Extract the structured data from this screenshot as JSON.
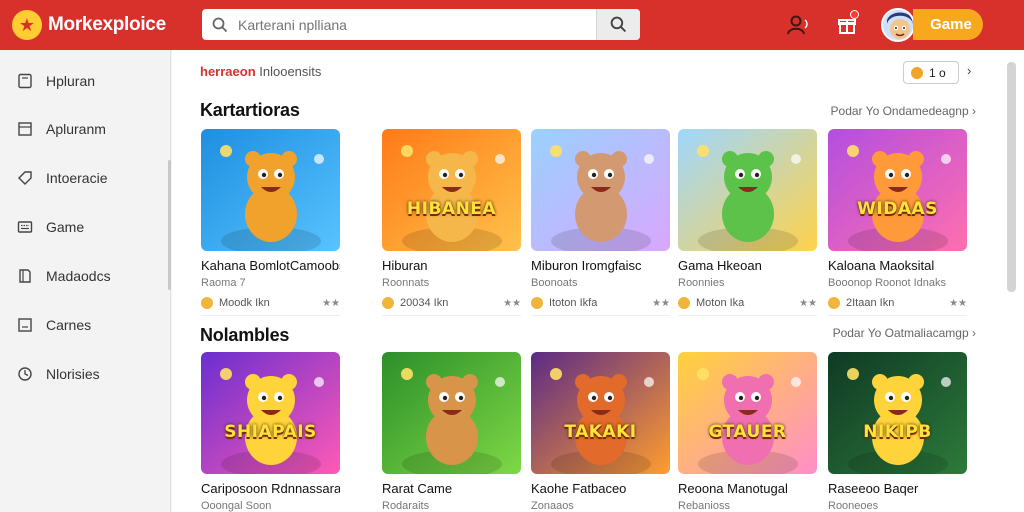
{
  "app": {
    "name": "Morkexploice",
    "logo_icon": "star-logo-icon",
    "brand_color": "#d8312c",
    "accent_color": "#f7a81f"
  },
  "search": {
    "placeholder": "Karterani nplliana"
  },
  "header": {
    "game_button": "Game"
  },
  "sidebar": {
    "items": [
      {
        "label": "Hpluran",
        "icon": "tablet-icon"
      },
      {
        "label": "Apluranm",
        "icon": "document-icon"
      },
      {
        "label": "Intoeracie",
        "icon": "tag-icon"
      },
      {
        "label": "Game",
        "icon": "keyboard-icon"
      },
      {
        "label": "Madaodcs",
        "icon": "bookmark-icon"
      },
      {
        "label": "Carnes",
        "icon": "image-icon"
      },
      {
        "label": "Nlorisies",
        "icon": "clock-icon"
      }
    ]
  },
  "main": {
    "subhead_red": "herraeon",
    "subhead_rest": "Inlooensits",
    "coins": "1 o",
    "sections": [
      {
        "title": "Kartartioras",
        "more": "Podar Yo Ondamedeagnp",
        "cards": [
          {
            "title": "Kahana BomlotCamoobs",
            "sub": "Raoma 7",
            "meta": "Moodk Ikn",
            "right": "★★"
          },
          {
            "title": "Hiburan",
            "sub": "Roonnats",
            "meta": "20034 Ikn",
            "right": "★★"
          },
          {
            "title": "Miburon Iromgfaisc",
            "sub": "Boonoats",
            "meta": "Itoton Ikfa",
            "right": "★★"
          },
          {
            "title": "Gama Hkeoan",
            "sub": "Roonnies",
            "meta": "Moton Ika",
            "right": "★★"
          },
          {
            "title": "Kaloana Maoksital",
            "sub": "Booonop Roonot Idnaks",
            "meta": "2Itaan Ikn",
            "right": "★★"
          }
        ]
      },
      {
        "title": "Nolambles",
        "more": "Podar Yo Oatmaliacamgp",
        "cards": [
          {
            "title": "Cariposoon Rdnnassaran",
            "sub": "Ooongal Soon",
            "meta": "",
            "right": ""
          },
          {
            "title": "Rarat Came",
            "sub": "Rodaraits",
            "meta": "",
            "right": ""
          },
          {
            "title": "Kaohe Fatbaceo",
            "sub": "Zonaaos",
            "meta": "",
            "right": ""
          },
          {
            "title": "Reoona Manotugal",
            "sub": "Rebanioss",
            "meta": "",
            "right": ""
          },
          {
            "title": "Raseeoo Baqer",
            "sub": "Rooneoes",
            "meta": "",
            "right": ""
          }
        ]
      }
    ]
  },
  "thumbs": {
    "row1": [
      {
        "name": "bear-hero-thumb",
        "bg1": "#1e8fe0",
        "bg2": "#58c3ff",
        "main": "#f1a22c"
      },
      {
        "name": "hibanea-logo-thumb",
        "bg1": "#ff7a18",
        "bg2": "#ffc24a",
        "main": "#f5b74a",
        "text": "HIBANEA"
      },
      {
        "name": "mouse-hero-thumb",
        "bg1": "#9ad1ff",
        "bg2": "#d8a7ff",
        "main": "#d39a72"
      },
      {
        "name": "green-alien-thumb",
        "bg1": "#9fd7ff",
        "bg2": "#ffd24a",
        "main": "#5cc24a"
      },
      {
        "name": "widaas-candy-thumb",
        "bg1": "#b44ee0",
        "bg2": "#ff6fae",
        "main": "#ff9a3a",
        "text": "WIDAAS"
      }
    ],
    "row2": [
      {
        "name": "shiapais-puzzle-thumb",
        "bg1": "#6a2ed0",
        "bg2": "#ff5ab5",
        "main": "#ffd33a",
        "text": "SHIAPAIS"
      },
      {
        "name": "dogs-friends-thumb",
        "bg1": "#2c8f2a",
        "bg2": "#7fd845",
        "main": "#d89448"
      },
      {
        "name": "takaki-fidaaks-thumb",
        "bg1": "#5b2a86",
        "bg2": "#ff9d2e",
        "main": "#e26a2a",
        "text": "TAKAKI"
      },
      {
        "name": "gtauer-fruonds-thumb",
        "bg1": "#ffd23a",
        "bg2": "#ff8ec9",
        "main": "#f06fb0",
        "text": "GTAUER"
      },
      {
        "name": "nikipb-toinbix-thumb",
        "bg1": "#0f3a25",
        "bg2": "#2d7a3a",
        "main": "#ffd33a",
        "text": "NIKIPB"
      }
    ]
  }
}
